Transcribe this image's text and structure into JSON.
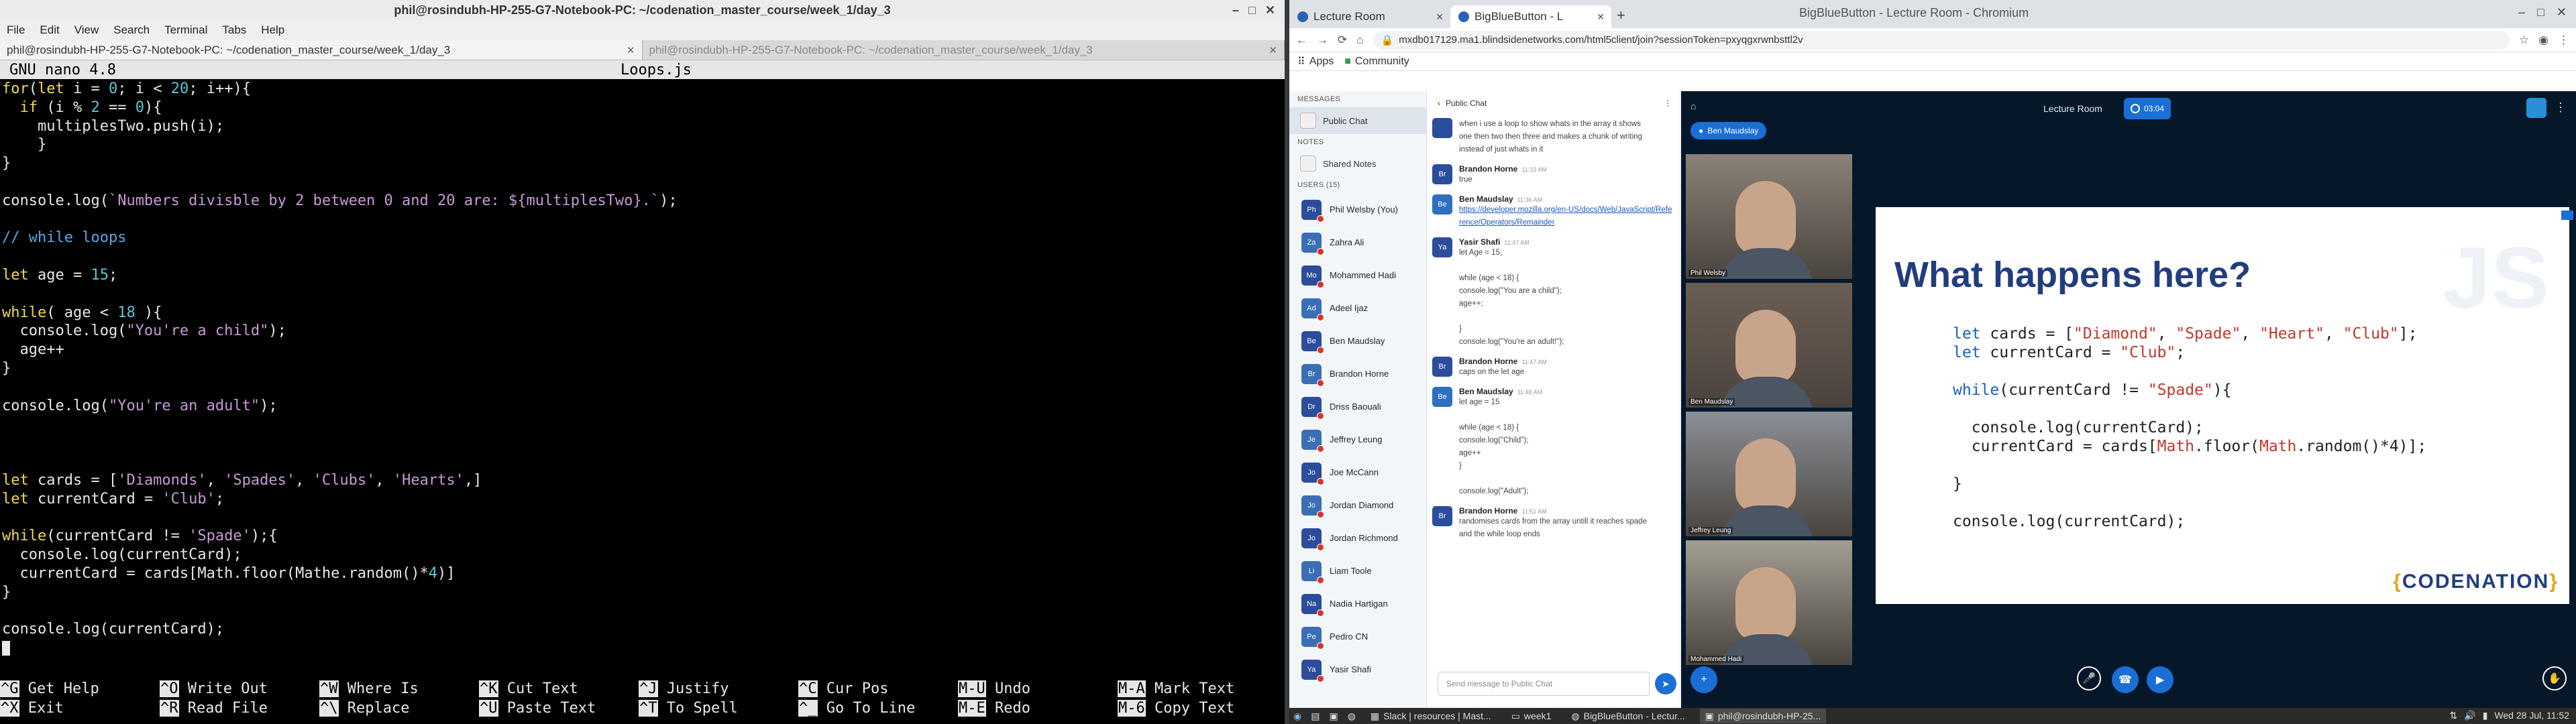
{
  "terminal": {
    "title": "phil@rosindubh-HP-255-G7-Notebook-PC: ~/codenation_master_course/week_1/day_3",
    "menu": [
      "File",
      "Edit",
      "View",
      "Search",
      "Terminal",
      "Tabs",
      "Help"
    ],
    "tabs": [
      "phil@rosindubh-HP-255-G7-Notebook-PC: ~/codenation_master_course/week_1/day_3",
      "phil@rosindubh-HP-255-G7-Notebook-PC: ~/codenation_master_course/week_1/day_3"
    ],
    "nano_version": "GNU nano 4.8",
    "filename": "Loops.js",
    "shortcuts": [
      {
        "key": "^G",
        "label": "Get Help"
      },
      {
        "key": "^X",
        "label": "Exit"
      },
      {
        "key": "^O",
        "label": "Write Out"
      },
      {
        "key": "^R",
        "label": "Read File"
      },
      {
        "key": "^W",
        "label": "Where Is"
      },
      {
        "key": "^\\",
        "label": "Replace"
      },
      {
        "key": "^K",
        "label": "Cut Text"
      },
      {
        "key": "^U",
        "label": "Paste Text"
      },
      {
        "key": "^J",
        "label": "Justify"
      },
      {
        "key": "^T",
        "label": "To Spell"
      },
      {
        "key": "^C",
        "label": "Cur Pos"
      },
      {
        "key": "^_",
        "label": "Go To Line"
      },
      {
        "key": "M-U",
        "label": "Undo"
      },
      {
        "key": "M-E",
        "label": "Redo"
      },
      {
        "key": "M-A",
        "label": "Mark Text"
      },
      {
        "key": "M-6",
        "label": "Copy Text"
      }
    ]
  },
  "code_lines": [
    "for(let i = 0; i < 20; i++){",
    "  if (i % 2 == 0){",
    "    multiplesTwo.push(i);",
    "    }",
    "}",
    "",
    "console.log(`Numbers divisble by 2 between 0 and 20 are: ${multiplesTwo}.`);",
    "",
    "// while loops",
    "",
    "let age = 15;",
    "",
    "while( age < 18 ){",
    "  console.log(\"You're a child\");",
    "  age++",
    "}",
    "",
    "console.log(\"You're an adult\");",
    "",
    "",
    "",
    "let cards = ['Diamonds', 'Spades', 'Clubs', 'Hearts',]",
    "let currentCard = 'Club';",
    "",
    "while(currentCard != 'Spade');{",
    "  console.log(currentCard);",
    "  currentCard = cards[Math.floor(Mathe.random()*4)]",
    "}",
    "",
    "console.log(currentCard);",
    ""
  ],
  "browser": {
    "window_title": "BigBlueButton - Lecture Room - Chromium",
    "tabs": [
      "Lecture Room",
      "BigBlueButton - L"
    ],
    "url": "mxdb017129.ma1.blindsidenetworks.com/html5client/join?sessionToken=pxyqgxrwnbsttl2v",
    "bookmarks": [
      "Apps",
      "Community"
    ]
  },
  "bbb": {
    "nav": {
      "messages_label": "MESSAGES",
      "public_chat": "Public Chat",
      "notes_label": "NOTES",
      "shared_notes": "Shared Notes",
      "users_label": "USERS (15)",
      "users": [
        {
          "initials": "Ph",
          "name": "Phil Welsby (You)"
        },
        {
          "initials": "Za",
          "name": "Zahra Ali"
        },
        {
          "initials": "Mo",
          "name": "Mohammed Hadi"
        },
        {
          "initials": "Ad",
          "name": "Adeel Ijaz"
        },
        {
          "initials": "Be",
          "name": "Ben Maudslay"
        },
        {
          "initials": "Br",
          "name": "Brandon Horne"
        },
        {
          "initials": "Dr",
          "name": "Driss Baouali"
        },
        {
          "initials": "Je",
          "name": "Jeffrey Leung"
        },
        {
          "initials": "Jo",
          "name": "Joe McCann"
        },
        {
          "initials": "Jo",
          "name": "Jordan Diamond"
        },
        {
          "initials": "Jo",
          "name": "Jordan Richmond"
        },
        {
          "initials": "Li",
          "name": "Liam Toole"
        },
        {
          "initials": "Na",
          "name": "Nadia Hartigan"
        },
        {
          "initials": "Pe",
          "name": "Pedro CN"
        },
        {
          "initials": "Ya",
          "name": "Yasir Shafi"
        }
      ]
    },
    "chat": {
      "title": "Public Chat",
      "messages": [
        {
          "initials": "",
          "name": "",
          "time": "",
          "lines": [
            "when i use a loop to show whats in the array it shows",
            "one then two then three and makes a chunk of writing",
            "instead of just whats in it"
          ]
        },
        {
          "initials": "Br",
          "name": "Brandon Horne",
          "time": "11:33 AM",
          "lines": [
            "true"
          ]
        },
        {
          "initials": "Be",
          "name": "Ben Maudslay",
          "time": "11:36 AM",
          "link": "https://developer.mozilla.org/en-US/docs/Web/JavaScript/Reference/Operators/Remainder",
          "lines": []
        },
        {
          "initials": "Ya",
          "name": "Yasir Shafi",
          "time": "11:47 AM",
          "lines": [
            "let Age = 15;",
            "",
            "while (age < 18) {",
            "console.log(\"You are a child\");",
            "age++;",
            "",
            "}",
            "console.log(\"You're an adult!\");"
          ]
        },
        {
          "initials": "Br",
          "name": "Brandon Horne",
          "time": "11:47 AM",
          "lines": [
            "caps on the let age"
          ]
        },
        {
          "initials": "Be",
          "name": "Ben Maudslay",
          "time": "11:48 AM",
          "lines": [
            "let age = 15",
            "",
            "while (age < 18) {",
            "console.log(\"Child\");",
            "age++",
            "}",
            "",
            "console.log(\"Adult\");"
          ]
        },
        {
          "initials": "Br",
          "name": "Brandon Horne",
          "time": "11:51 AM",
          "lines": [
            "randomises cards from the array untill it reaches spade",
            "and the while loop ends"
          ]
        }
      ],
      "input_placeholder": "Send message to Public Chat"
    },
    "room_title": "Lecture Room",
    "recording_time": "03:04",
    "presenter": "Ben Maudslay",
    "videos": [
      {
        "name": "Phil Welsby",
        "bg": "#8a8278"
      },
      {
        "name": "Ben Maudslay",
        "bg": "#6b5e54"
      },
      {
        "name": "Jeffrey Leung",
        "bg": "#8a8f96"
      },
      {
        "name": "Mohammed Hadi",
        "bg": "#a39e94"
      }
    ],
    "slide": {
      "title": "What happens here?",
      "code": [
        "let cards = [\"Diamond\", \"Spade\", \"Heart\", \"Club\"];",
        "let currentCard = \"Club\";",
        "",
        "while(currentCard != \"Spade\"){",
        "",
        "  console.log(currentCard);",
        "  currentCard = cards[Math.floor(Math.random()*4)];",
        "",
        "}",
        "",
        "console.log(currentCard);"
      ],
      "js_mark": "JS",
      "logo": "CODENATION"
    }
  },
  "taskbar": {
    "items": [
      "Slack | resources | Mast...",
      "week1",
      "BigBlueButton - Lectur...",
      "phil@rosindubh-HP-25..."
    ],
    "clock": "Wed 28 Jul, 11:52"
  },
  "colors": {
    "accent": "#1a6fd6",
    "nano_keyword": "#f2d94b",
    "nano_string": "#c79ad6",
    "nano_number": "#5cc8d8",
    "nano_comment": "#58a8e8"
  }
}
